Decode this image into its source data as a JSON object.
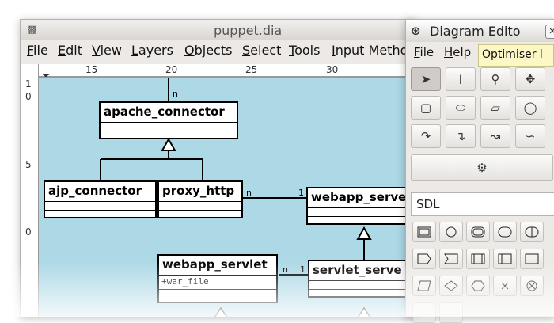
{
  "main_window": {
    "title": "puppet.dia",
    "menu": [
      "File",
      "Edit",
      "View",
      "Layers",
      "Objects",
      "Select",
      "Tools",
      "Input Metho"
    ],
    "menu_mnemonics": [
      "F",
      "E",
      "V",
      "L",
      "O",
      "S",
      "T",
      "I"
    ]
  },
  "ruler": {
    "h_ticks": [
      "15",
      "20",
      "25",
      "30"
    ],
    "v_ticks": [
      "1",
      "0",
      "5",
      "0"
    ]
  },
  "diagram": {
    "classes": {
      "apache_connector": {
        "name": "apache_connector"
      },
      "ajp_connector": {
        "name": "ajp_connector"
      },
      "proxy_http": {
        "name": "proxy_http"
      },
      "webapp_server": {
        "name": "webapp_serve"
      },
      "webapp_servlet": {
        "name": "webapp_servlet",
        "attribute": "+war_file"
      },
      "servlet_server": {
        "name": "servlet_serve"
      }
    },
    "labels": {
      "apache_n": "n",
      "proxy_n": "n",
      "proxy_1": "1",
      "servlet_n": "n",
      "servlet_1": "1"
    }
  },
  "diagram_editor": {
    "title": "Diagram Edito",
    "menu": [
      "File",
      "Help"
    ],
    "menu_mnemonics": [
      "F",
      "H"
    ],
    "tooltip": "Optimiser l",
    "sheet": "SDL"
  },
  "colors": {
    "canvas_bg": "#add8e6",
    "window_bg": "#ece9e6",
    "tooltip_bg": "#fbf8c6"
  }
}
